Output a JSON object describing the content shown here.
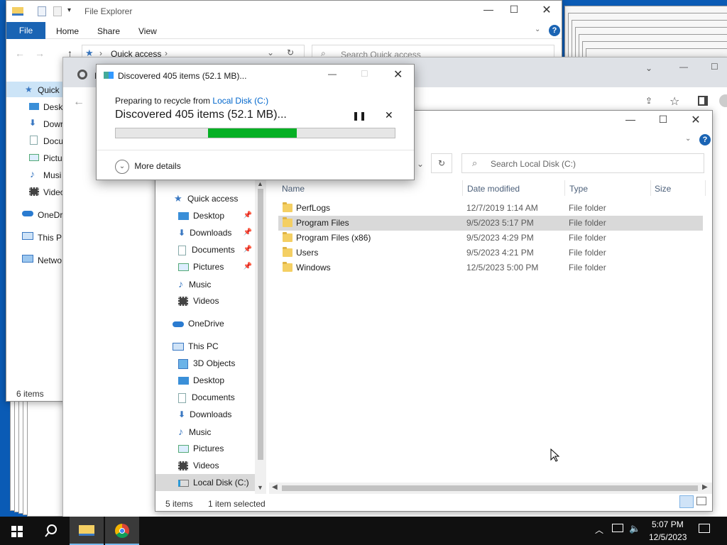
{
  "explorer_back": {
    "title": "File Explorer",
    "ribbon_tabs": [
      "File",
      "Home",
      "Share",
      "View"
    ],
    "address": "Quick access",
    "search_placeholder": "Search Quick access",
    "nav_items": [
      "Quick",
      "Deskt",
      "Dowr",
      "Docu",
      "Pictu",
      "Musi",
      "Video",
      "OneDr",
      "This P",
      "Netwo"
    ],
    "status": "6 items"
  },
  "chrome_back": {
    "tab_initial": "N"
  },
  "progress_dialog": {
    "title": "Discovered 405 items (52.1 MB)...",
    "preparing_label": "Preparing to recycle from",
    "preparing_link": "Local Disk (C:)",
    "heading": "Discovered 405 items (52.1 MB)...",
    "progress": 0.65,
    "more_details": "More details"
  },
  "explorer_front": {
    "search_placeholder": "Search Local Disk (C:)",
    "columns": {
      "name": "Name",
      "date": "Date modified",
      "type": "Type",
      "size": "Size"
    },
    "quick_access": "Quick access",
    "quick_items": [
      "Desktop",
      "Downloads",
      "Documents",
      "Pictures",
      "Music",
      "Videos"
    ],
    "onedrive": "OneDrive",
    "this_pc": "This PC",
    "pc_items": [
      "3D Objects",
      "Desktop",
      "Documents",
      "Downloads",
      "Music",
      "Pictures",
      "Videos",
      "Local Disk (C:)"
    ],
    "files": [
      {
        "name": "PerfLogs",
        "date": "12/7/2019 1:14 AM",
        "type": "File folder"
      },
      {
        "name": "Program Files",
        "date": "9/5/2023 5:17 PM",
        "type": "File folder"
      },
      {
        "name": "Program Files (x86)",
        "date": "9/5/2023 4:29 PM",
        "type": "File folder"
      },
      {
        "name": "Users",
        "date": "9/5/2023 4:21 PM",
        "type": "File folder"
      },
      {
        "name": "Windows",
        "date": "12/5/2023 5:00 PM",
        "type": "File folder"
      }
    ],
    "status_items": "5 items",
    "status_selected": "1 item selected"
  },
  "taskbar": {
    "time": "5:07 PM",
    "date": "12/5/2023"
  },
  "colors": {
    "accent": "#0063b1",
    "progress_fill": "#06b025",
    "selection": "#d9d9d9"
  }
}
